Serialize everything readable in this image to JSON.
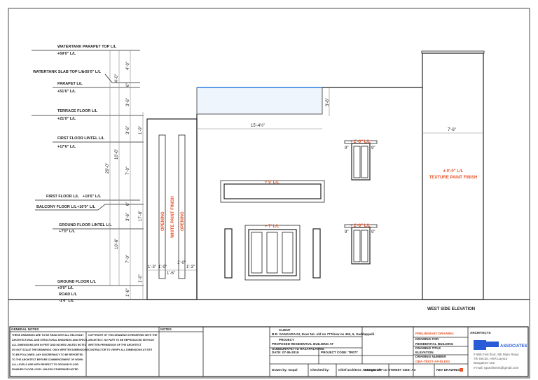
{
  "levels": [
    {
      "name": "WATERTANK PARAPET TOP L/L",
      "value": "+59'0\" L/L"
    },
    {
      "name": "WATERTANK SLAB TOP L/L",
      "value": "+55'0\" L/L"
    },
    {
      "name": "PARAPET L/L",
      "value": "+51'6\" L/L"
    },
    {
      "name": "TERRACE FLOOR L/L",
      "value": "+21'0\" L/L"
    },
    {
      "name": "FIRST FLOOR LINTEL L/L",
      "value": "+17'6\" L/L"
    },
    {
      "name": "FIRST FLOOR L/L",
      "value": "+10'6\" L/L"
    },
    {
      "name": "BALCONY FLOOR L/L",
      "value": "+10'0\" L/L"
    },
    {
      "name": "GROUND FLOOR LINTEL L/L",
      "value": "+7'0\" L/L"
    },
    {
      "name": "GROUND FLOOR L/L",
      "value": "+0'0\" L/L"
    },
    {
      "name": "ROAD L/L",
      "value": "-1'6\" L/L"
    }
  ],
  "dims": {
    "d1": "4'-0\"",
    "d2": "4'-0\"",
    "d3": "6\"",
    "d4": "3'-6\"",
    "d5": "3'-6\"",
    "d6": "1'-9\"",
    "d7": "10'-6\"",
    "d8": "29'-0\"",
    "d9": "7'-0\"",
    "d10": "6\"",
    "d11": "3'-6\"",
    "d12": "17'-6\"",
    "d13": "10'-6\"",
    "d14": "7'-0\"",
    "d15": "1'-0\"",
    "d16": "1'-6\"",
    "tank_h": "3'-6\"",
    "tank_w": "15'-4½\"",
    "tower_w": "7'-6\"",
    "w1": "1'-3\"",
    "w2": "1'-0\"",
    "w3": "1'-6\"",
    "w4": "1'-0\"",
    "w5": "1'-3\"",
    "sill": "9\""
  },
  "labels": {
    "opening": "OPENING",
    "white_paint": "WHITE PAINT FINISH",
    "tower_level": "± 0'-0\" L/L",
    "tower_finish": "TEXTURE PAINT FINISH",
    "win_long": "+ 9' L/L",
    "win_big": "+ 7' L/L",
    "win_top": "+ 2'-0\" L/L",
    "win_bottom": "+ 2'-0\" L/L",
    "view_title": "WEST SIDE ELEVATION"
  },
  "title_block": {
    "general_notes": "GENERAL NOTES",
    "notes_text": [
      "THESE DRAWINGS ARE TO BE READ WITH ALL RELEVANT",
      "ARCHITECTURAL AND STRUCTURAL DRAWINGS AND SPECS.",
      "ALL DIMENSIONS ARE IN FEET AND INCHES UNLESS NOTED",
      "DO NOT SCALE THE DRAWINGS. ONLY WRITTEN DIMENSIONS",
      "TO BE FOLLOWED. ANY DISCREPANCY TO BE REPORTED",
      "TO THE ARCHITECT BEFORE COMMENCEMENT OF WORK",
      "ALL LEVELS ARE WITH RESPECT TO GROUND FLOOR",
      "FINISHED FLOOR LEVEL UNLESS OTHERWISE NOTED"
    ],
    "notes_text2": [
      "COPYRIGHT OF THIS DRAWING IS RESERVED WITH THE",
      "ARCHITECT. NO PART TO BE REPRODUCED WITHOUT",
      "WRITTEN PERMISSION OF THE ARCHITECT",
      "CONTRACTOR TO VERIFY ALL DIMENSIONS AT SITE"
    ],
    "notes": "NOTES",
    "client_label": "CLIENT",
    "client": "B.R. GANGARAJU, Door No: old no 777/new no 452, 6, Gaddappalli",
    "project_label": "PROJECT",
    "project1": "PROPOSED RESIDENTIAL BUILDING AT",
    "project2": "GOBBURAPETTU RAJAPALAYAM.",
    "date": "DATE: 07-06-2019",
    "project_code": "PROJECT CODE: TR077",
    "drawn": "Drawn by: Gopal",
    "checked": "Checked by:",
    "chief": "Chief architect: Ar.Ragam R",
    "scale": "SCALE: 1/8\"=1'-0\"",
    "sheet": "SHEET SIZE: A3",
    "rev": "REV DRAWING:",
    "status": "PRELIMINARY DRAWING",
    "drawing_for_label": "DRAWING FOR",
    "drawing_for": "RESIDENTIAL BUILDING",
    "drawing_title_label": "DRAWING TITLE",
    "drawing_title": "ELEVATION",
    "drawing_no_label": "DRAWING NUMBER",
    "drawing_no": "GBA-TR077-AP-ELE02",
    "architects": "ARCHITECTS",
    "logo": "ASSOCIATES",
    "addr1": "# 988,First floor, 9th Main Road,",
    "addr2": "7th Sector, HSR Layout",
    "addr3": "Bangalore-102",
    "addr4": "e-mail: rgarchitects@gmail.com"
  },
  "colors": {
    "accent": "#e8542a",
    "glass": "#5b9be0",
    "logo": "#2a5bd7"
  }
}
